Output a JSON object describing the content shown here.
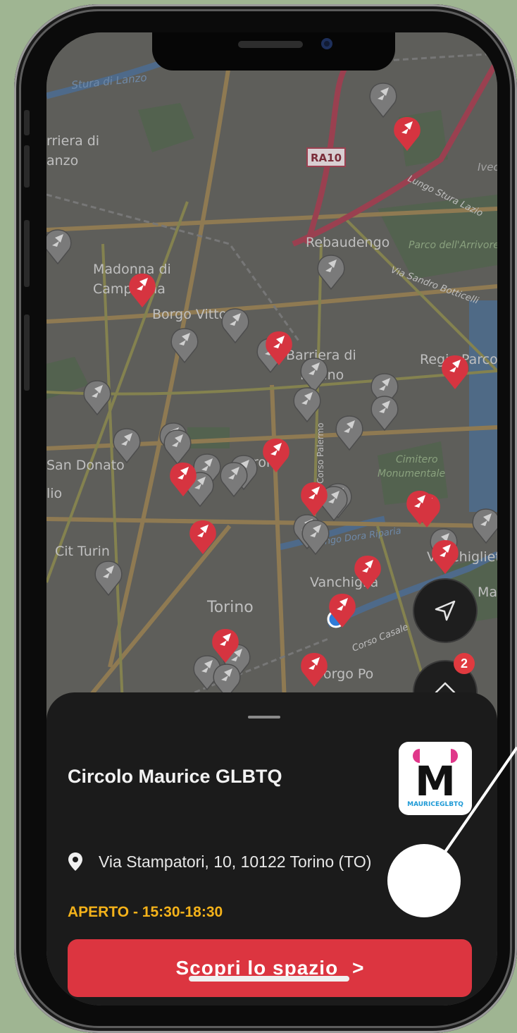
{
  "map": {
    "labels": [
      {
        "key": "stura",
        "text": "Stura di Lanzo"
      },
      {
        "key": "barriera-lanzo-1",
        "text": "rriera di"
      },
      {
        "key": "barriera-lanzo-2",
        "text": "anzo"
      },
      {
        "key": "ra10",
        "text": "RA10"
      },
      {
        "key": "ivec",
        "text": "Ivec"
      },
      {
        "key": "lungo-stura",
        "text": "Lungo Stura Lazio"
      },
      {
        "key": "rebaudengo",
        "text": "Rebaudengo"
      },
      {
        "key": "parco-arrivore",
        "text": "Parco dell'Arrivore"
      },
      {
        "key": "via-botticelli",
        "text": "Via Sandro Botticelli"
      },
      {
        "key": "madonna-1",
        "text": "Madonna di"
      },
      {
        "key": "madonna-2",
        "text": "Campagna"
      },
      {
        "key": "borgo-vittoria",
        "text": "Borgo Vittoria"
      },
      {
        "key": "barriera-milano-1",
        "text": "Barriera di"
      },
      {
        "key": "barriera-milano-2",
        "text": "Milano"
      },
      {
        "key": "regio-parco",
        "text": "Regio Parco"
      },
      {
        "key": "san-donato",
        "text": "San Donato"
      },
      {
        "key": "aurora",
        "text": "Aurora"
      },
      {
        "key": "corso-palermo",
        "text": "Corso Palermo"
      },
      {
        "key": "cimitero-1",
        "text": "Cimitero"
      },
      {
        "key": "cimitero-2",
        "text": "Monumentale"
      },
      {
        "key": "lio",
        "text": "lio"
      },
      {
        "key": "cit-turin",
        "text": "Cit Turin"
      },
      {
        "key": "lungo-dora",
        "text": "Lungo Dora Riparia"
      },
      {
        "key": "vanchiglia",
        "text": "Vanchiglia"
      },
      {
        "key": "vanchiglietta",
        "text": "Vanchiglietta"
      },
      {
        "key": "torino",
        "text": "Torino"
      },
      {
        "key": "corso-casale",
        "text": "Corso Casale"
      },
      {
        "key": "borgo-po",
        "text": "Borgo Po"
      },
      {
        "key": "madonna-pilone",
        "text": "Madonna del Pilone"
      }
    ]
  },
  "controls": {
    "locate_icon": "navigation-arrow-icon",
    "layers_icon": "layers-icon",
    "layers_badge": "2"
  },
  "sheet": {
    "title": "Circolo Maurice GLBTQ",
    "address": "Via Stampatori, 10, 10122 Torino (TO)",
    "status": "APERTO - 15:30-18:30",
    "cta_label": "Scopri lo spazio",
    "cta_chevron": ">",
    "logo": {
      "letter": "M",
      "caption": "MAURICEGLBTQ"
    }
  },
  "colors": {
    "accent_red": "#dc3540",
    "status_yellow": "#f4b21a",
    "sheet_bg": "#1b1b1b",
    "page_bg": "#9fb592",
    "pin_red": "#d63440",
    "pin_gray": "#7a7a7a"
  }
}
